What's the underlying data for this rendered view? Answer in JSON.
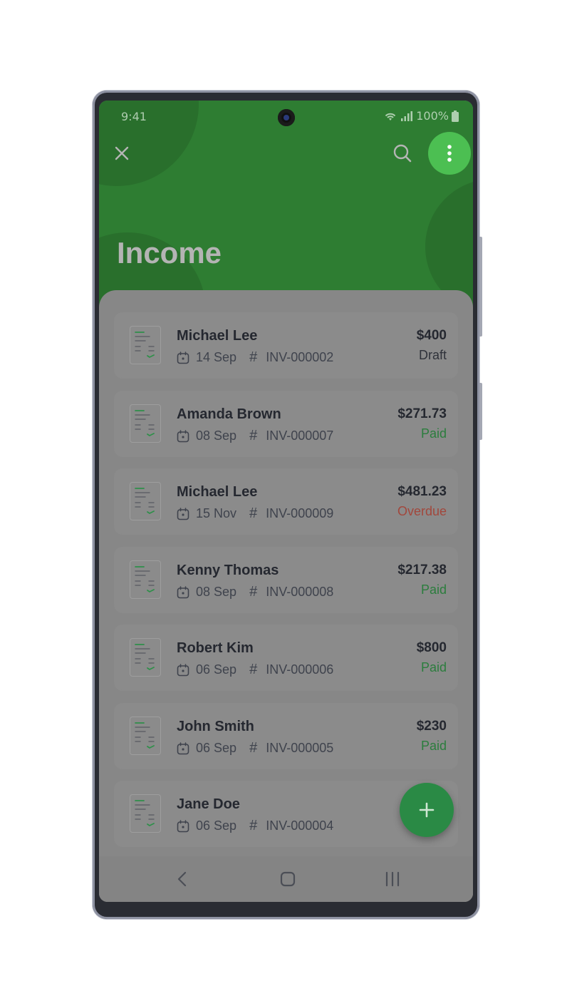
{
  "status_bar": {
    "time": "9:41",
    "battery": "100%"
  },
  "header": {
    "title": "Income"
  },
  "invoices": [
    {
      "name": "Michael Lee",
      "date": "14 Sep",
      "number": "INV-000002",
      "amount": "$400",
      "status": "Draft",
      "status_color": "#2f323a"
    },
    {
      "name": "Amanda Brown",
      "date": "08 Sep",
      "number": "INV-000007",
      "amount": "$271.73",
      "status": "Paid",
      "status_color": "#2b7d3d"
    },
    {
      "name": "Michael Lee",
      "date": "15 Nov",
      "number": "INV-000009",
      "amount": "$481.23",
      "status": "Overdue",
      "status_color": "#a2473c"
    },
    {
      "name": "Kenny Thomas",
      "date": "08 Sep",
      "number": "INV-000008",
      "amount": "$217.38",
      "status": "Paid",
      "status_color": "#2b7d3d"
    },
    {
      "name": "Robert Kim",
      "date": "06 Sep",
      "number": "INV-000006",
      "amount": "$800",
      "status": "Paid",
      "status_color": "#2b7d3d"
    },
    {
      "name": "John Smith",
      "date": "06 Sep",
      "number": "INV-000005",
      "amount": "$230",
      "status": "Paid",
      "status_color": "#2b7d3d"
    },
    {
      "name": "Jane Doe",
      "date": "06 Sep",
      "number": "INV-000004",
      "amount": "",
      "status": "",
      "status_color": "#2b7d3d"
    }
  ],
  "colors": {
    "header_green": "#2e7d32",
    "accent_green": "#4cbf52",
    "fab_green": "#2a8a45"
  },
  "icons": {
    "close": "close-icon",
    "search": "search-icon",
    "more": "more-vertical-icon",
    "add": "plus-icon",
    "invoice": "invoice-document-icon",
    "calendar": "calendar-icon",
    "hash": "hash-icon"
  }
}
